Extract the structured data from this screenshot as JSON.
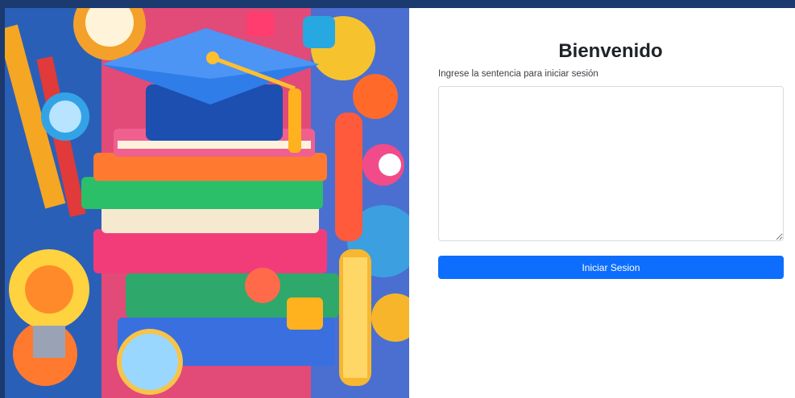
{
  "login": {
    "title": "Bienvenido",
    "prompt_label": "Ingrese la sentencia para iniciar sesión",
    "sentence_value": "",
    "submit_label": "Iniciar Sesion"
  },
  "colors": {
    "background": "#1b3a6f",
    "panel": "#ffffff",
    "button": "#0d6efd",
    "button_text": "#ffffff"
  },
  "illustration": {
    "subject": "education-books-graduation-cap-illustration"
  }
}
